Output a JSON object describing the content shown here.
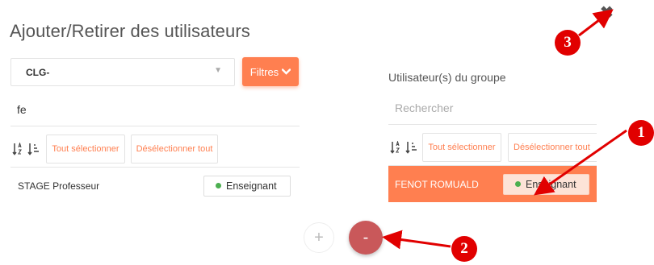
{
  "dialog": {
    "title": "Ajouter/Retirer des utilisateurs",
    "close_label": "✖"
  },
  "left": {
    "select_value": "CLG-",
    "select_caret": "▼",
    "filters_label": "Filtres",
    "search_value": "fe",
    "select_all": "Tout sélectionner",
    "deselect_all": "Désélectionner tout",
    "users": [
      {
        "name": "STAGE Professeur",
        "role": "Enseignant"
      }
    ]
  },
  "right": {
    "title": "Utilisateur(s) du groupe",
    "search_placeholder": "Rechercher",
    "select_all": "Tout sélectionner",
    "deselect_all": "Désélectionner tout",
    "users": [
      {
        "name": "FENOT ROMUALD",
        "role": "Enseignant",
        "selected": true
      }
    ]
  },
  "actions": {
    "add_label": "+",
    "remove_label": "-"
  },
  "annotations": {
    "markers": [
      "1",
      "2",
      "3"
    ],
    "color": "#e10000"
  },
  "colors": {
    "accent": "#ff7f50",
    "remove": "#c9585a",
    "status_dot": "#4caf50"
  }
}
